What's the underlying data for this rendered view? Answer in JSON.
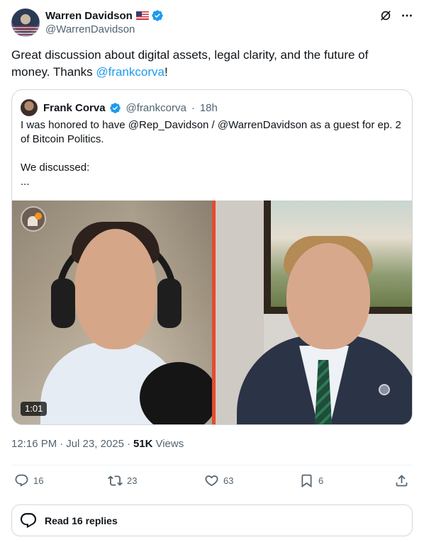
{
  "author": {
    "name": "Warren Davidson",
    "handle": "@WarrenDavidson"
  },
  "tweet": {
    "text_before": "Great discussion about digital assets, legal clarity, and the future of money. Thanks ",
    "mention": "@frankcorva",
    "text_after": "!"
  },
  "quote": {
    "name": "Frank Corva",
    "handle": "@frankcorva",
    "dot": "·",
    "time": "18h",
    "text": "I was honored to have @Rep_Davidson / @WarrenDavidson as a guest for ep. 2 of Bitcoin Politics.\n\nWe discussed:\n...",
    "video_duration": "1:01"
  },
  "meta": {
    "time": "12:16 PM",
    "date": "Jul 23, 2025",
    "sep1": "·",
    "sep2": "·",
    "views_count": "51K",
    "views_label": "Views"
  },
  "actions": {
    "replies": "16",
    "reposts": "23",
    "likes": "63",
    "bookmarks": "6"
  },
  "read_replies": "Read 16 replies",
  "colors": {
    "accent": "#1d9bf0",
    "secondary_text": "#536471",
    "video_divider": "#e64a2e"
  }
}
